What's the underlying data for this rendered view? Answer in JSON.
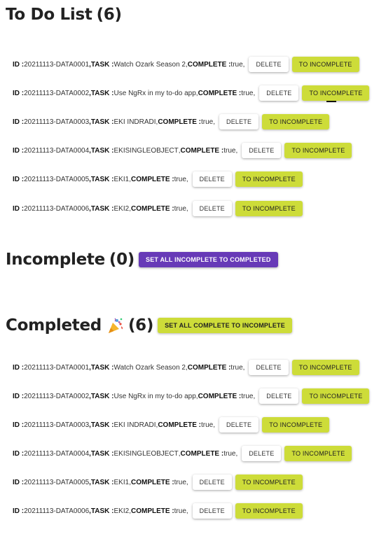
{
  "todo": {
    "heading": "To Do List",
    "count": "(6)",
    "delete_label": "DELETE",
    "to_incomplete_label": "TO INCOMPLETE",
    "items": [
      {
        "id": "20211113-DATA0001",
        "task": "Watch Ozark Season 2",
        "complete": "true"
      },
      {
        "id": "20211113-DATA0002",
        "task": "Use NgRx in my to-do app",
        "complete": "true"
      },
      {
        "id": "20211113-DATA0003",
        "task": "EKI INDRADI",
        "complete": "true"
      },
      {
        "id": "20211113-DATA0004",
        "task": "EKISINGLEOBJECT",
        "complete": "true"
      },
      {
        "id": "20211113-DATA0005",
        "task": "EKI1",
        "complete": "true"
      },
      {
        "id": "20211113-DATA0006",
        "task": "EKI2",
        "complete": "true"
      }
    ]
  },
  "incomplete": {
    "heading": "Incomplete",
    "count": "(0)",
    "action_label": "SET ALL INCOMPLETE TO COMPLETED"
  },
  "completed": {
    "heading": "Completed",
    "count": "(6)",
    "icon": "party-popper-icon",
    "action_label": "SET ALL COMPLETE TO INCOMPLETE",
    "delete_label": "DELETE",
    "to_incomplete_label": "TO INCOMPLETE",
    "items": [
      {
        "id": "20211113-DATA0001",
        "task": "Watch Ozark Season 2",
        "complete": "true"
      },
      {
        "id": "20211113-DATA0002",
        "task": "Use NgRx in my to-do app",
        "complete": "true"
      },
      {
        "id": "20211113-DATA0003",
        "task": "EKI INDRADI",
        "complete": "true"
      },
      {
        "id": "20211113-DATA0004",
        "task": "EKISINGLEOBJECT",
        "complete": "true"
      },
      {
        "id": "20211113-DATA0005",
        "task": "EKI1",
        "complete": "true"
      },
      {
        "id": "20211113-DATA0006",
        "task": "EKI2",
        "complete": "true"
      }
    ]
  },
  "labels": {
    "id": "ID :",
    "task": "TASK :",
    "complete": "COMPLETE :",
    "comma": ","
  },
  "colors": {
    "lime": "#cddc39",
    "purple": "#673ab7"
  }
}
